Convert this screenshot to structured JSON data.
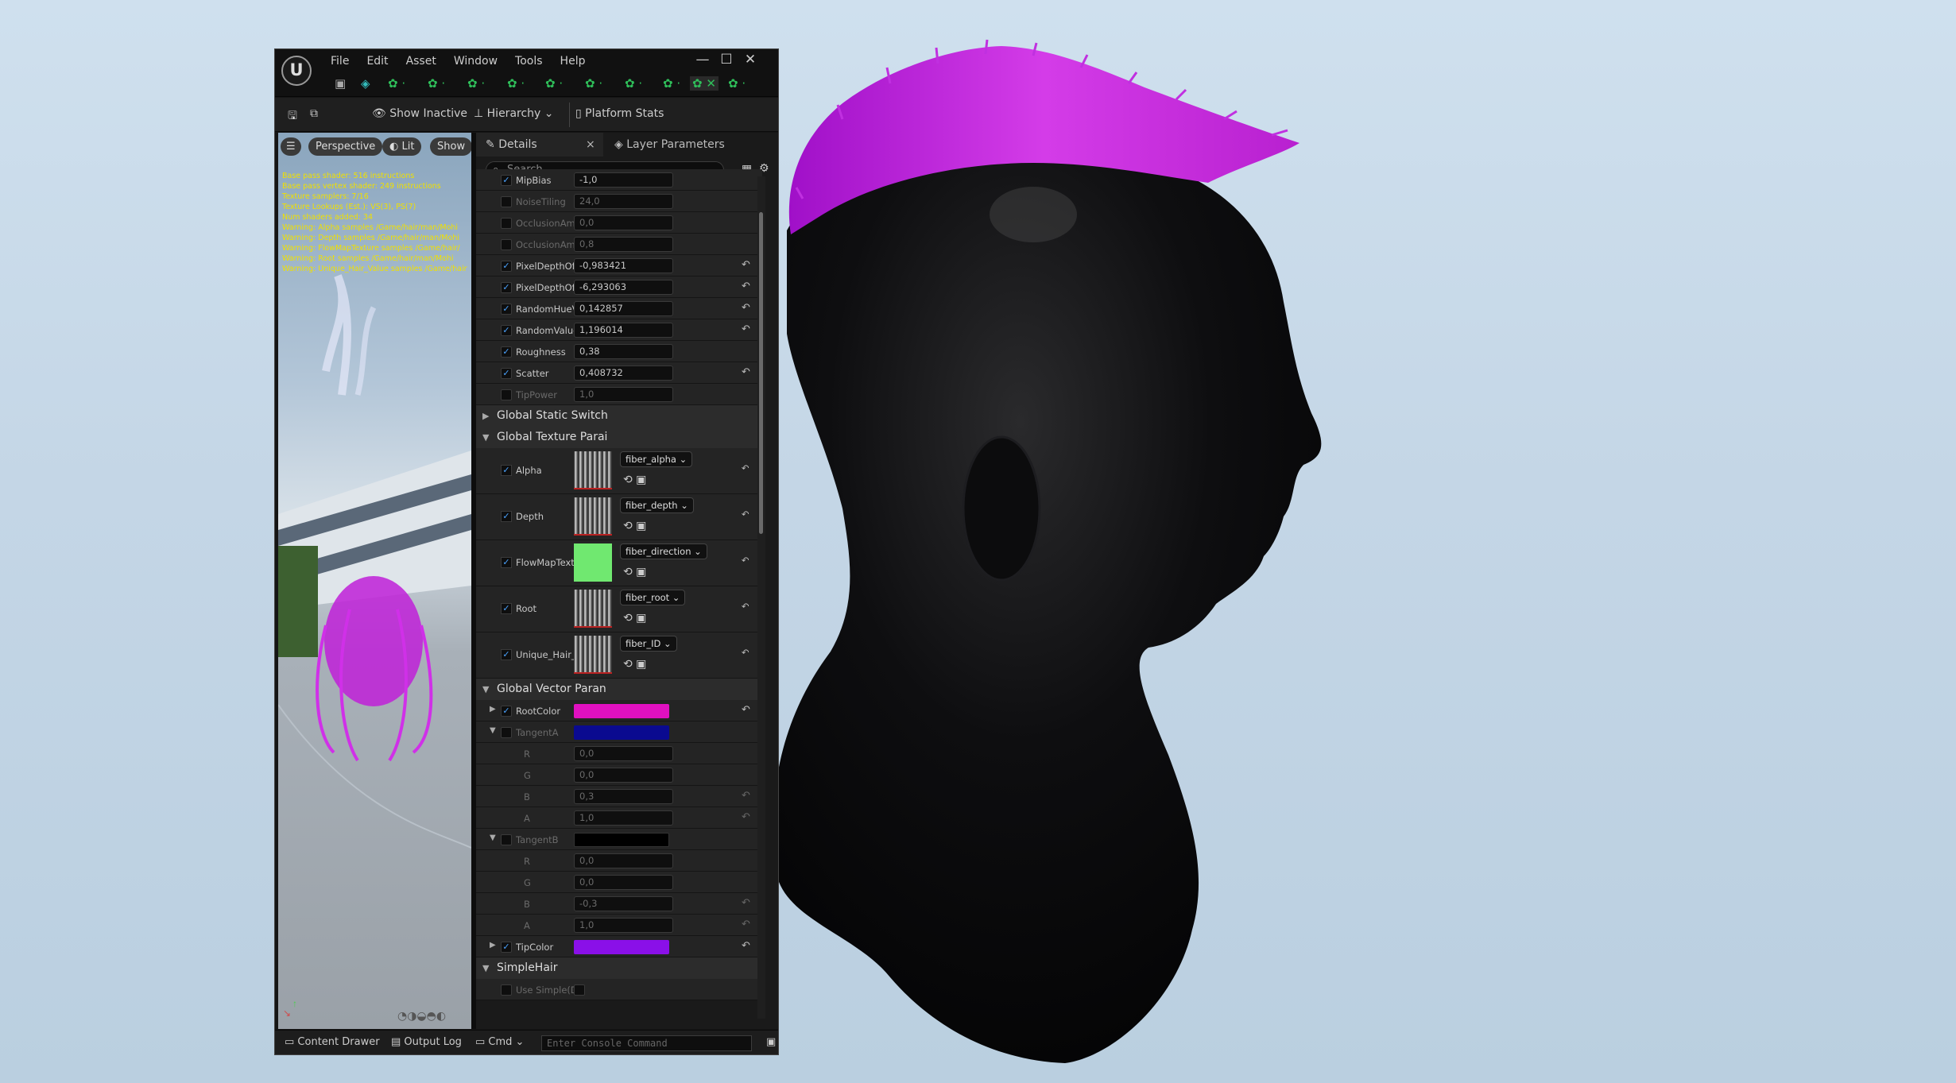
{
  "window": {
    "logo": "U",
    "menu": [
      "File",
      "Edit",
      "Asset",
      "Window",
      "Tools",
      "Help"
    ],
    "controls": {
      "minimize": "—",
      "maximize": "☐",
      "close": "✕"
    }
  },
  "toolbar": {
    "save_icon": "save-icon",
    "browse_icon": "browse-icon",
    "show_inactive": "Show Inactive",
    "hierarchy": "Hierarchy",
    "platform_stats": "Platform Stats"
  },
  "viewport": {
    "perspective": "Perspective",
    "lit": "Lit",
    "show": "Show",
    "stats": [
      "Base pass shader: 516 instructions",
      "Base pass vertex shader: 249 instructions",
      "Texture samplers: 7/16",
      "Texture Lookups (Est.): VS(3), PS(7)",
      "Num shaders added: 34",
      "Warning: Alpha samples /Game/hair/man/Mohi",
      "Warning: Depth samples /Game/hair/man/Mohi",
      "Warning: FlowMapTexture samples /Game/hair/",
      "Warning: Root samples /Game/hair/man/Mohi",
      "Warning: Unique_Hair_Value samples /Game/hair"
    ]
  },
  "details": {
    "tab_details": "Details",
    "tab_layer": "Layer Parameters",
    "search_placeholder": "Search",
    "scalar_rows": [
      {
        "label": "MipBias",
        "value": "-1,0",
        "checked": true,
        "reset": false
      },
      {
        "label": "NoiseTiling",
        "value": "24,0",
        "checked": false,
        "reset": false
      },
      {
        "label": "OcclusionAmt...",
        "value": "0,0",
        "checked": false,
        "reset": false
      },
      {
        "label": "OcclusionAmt...",
        "value": "0,8",
        "checked": false,
        "reset": false
      },
      {
        "label": "PixelDepthOff...",
        "value": "-0,983421",
        "checked": true,
        "reset": true
      },
      {
        "label": "PixelDepthOff...",
        "value": "-6,293063",
        "checked": true,
        "reset": true
      },
      {
        "label": "RandomHueV...",
        "value": "0,142857",
        "checked": true,
        "reset": true
      },
      {
        "label": "RandomValue...",
        "value": "1,196014",
        "checked": true,
        "reset": true
      },
      {
        "label": "Roughness",
        "value": "0,38",
        "checked": true,
        "reset": false
      },
      {
        "label": "Scatter",
        "value": "0,408732",
        "checked": true,
        "reset": true
      },
      {
        "label": "TipPower",
        "value": "1,0",
        "checked": false,
        "reset": false
      }
    ],
    "section_static_switch": "Global Static Switch",
    "section_texture": "Global Texture Parai",
    "texture_rows": [
      {
        "label": "Alpha",
        "asset": "fiber_alpha"
      },
      {
        "label": "Depth",
        "asset": "fiber_depth"
      },
      {
        "label": "FlowMapText...",
        "asset": "fiber_direction"
      },
      {
        "label": "Root",
        "asset": "fiber_root"
      },
      {
        "label": "Unique_Hair_V...",
        "asset": "fiber_ID"
      }
    ],
    "section_vector": "Global Vector Paran",
    "root_color": {
      "label": "RootColor",
      "color": "#e010c0"
    },
    "tangent_a": {
      "label": "TangentA",
      "color": "#0a0a90",
      "r": "0,0",
      "g": "0,0",
      "b": "0,3",
      "a": "1,0"
    },
    "tangent_b": {
      "label": "TangentB",
      "color": "#000000",
      "r": "0,0",
      "g": "0,0",
      "b": "-0,3",
      "a": "1,0"
    },
    "channel_labels": {
      "r": "R",
      "g": "G",
      "b": "B",
      "a": "A"
    },
    "tip_color": {
      "label": "TipColor",
      "color": "#8a10e8"
    },
    "section_simple_hair": "SimpleHair",
    "use_simple": "Use Simple(Di..."
  },
  "status": {
    "content_drawer": "Content Drawer",
    "output_log": "Output Log",
    "cmd": "Cmd",
    "console_placeholder": "Enter Console Command"
  }
}
